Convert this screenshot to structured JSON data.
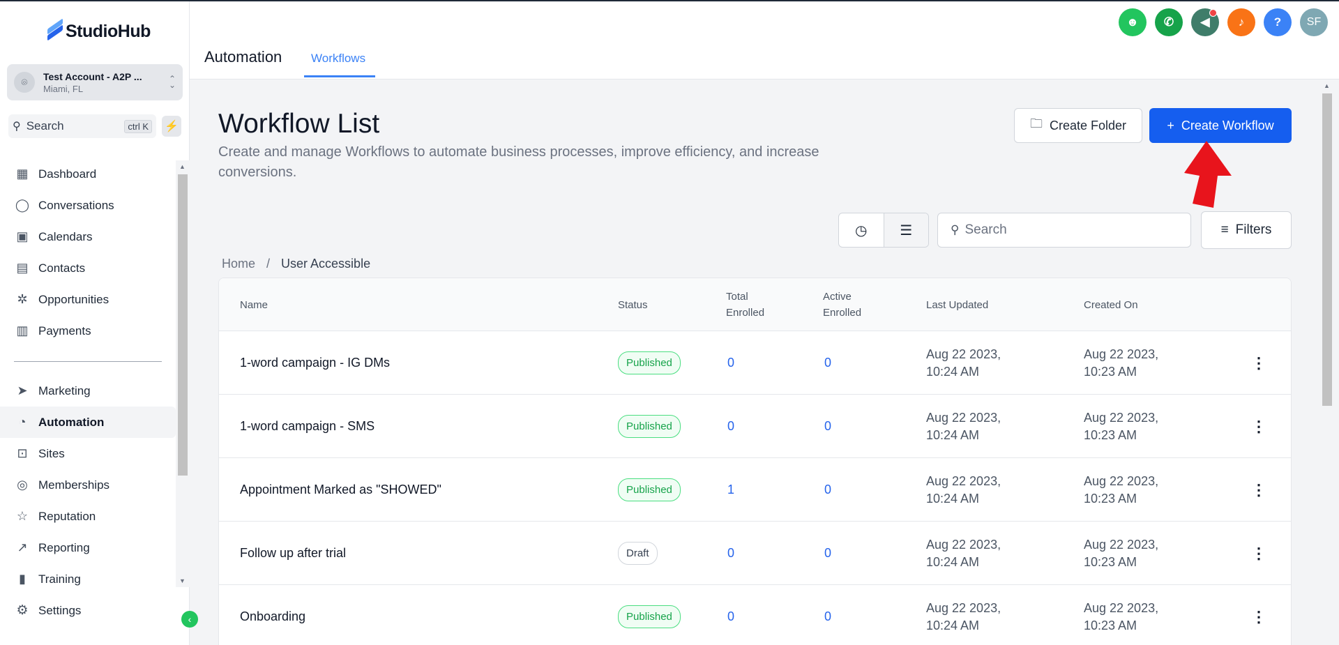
{
  "brand": {
    "name": "StudioHub"
  },
  "account": {
    "name": "Test Account - A2P ...",
    "location": "Miami, FL"
  },
  "sidebar": {
    "search_label": "Search",
    "search_shortcut": "ctrl K",
    "items": [
      {
        "label": "Dashboard",
        "icon": "dashboard-icon",
        "glyph": "▦"
      },
      {
        "label": "Conversations",
        "icon": "chat-bubble-icon",
        "glyph": "◯"
      },
      {
        "label": "Calendars",
        "icon": "calendar-icon",
        "glyph": "▣"
      },
      {
        "label": "Contacts",
        "icon": "contacts-book-icon",
        "glyph": "▤"
      },
      {
        "label": "Opportunities",
        "icon": "opportunities-icon",
        "glyph": "✲"
      },
      {
        "label": "Payments",
        "icon": "payments-icon",
        "glyph": "▥"
      }
    ],
    "items2": [
      {
        "label": "Marketing",
        "icon": "send-icon",
        "glyph": "➤"
      },
      {
        "label": "Automation",
        "icon": "automation-icon",
        "glyph": "◔",
        "active": true
      },
      {
        "label": "Sites",
        "icon": "sites-icon",
        "glyph": "⊡"
      },
      {
        "label": "Memberships",
        "icon": "memberships-icon",
        "glyph": "◎"
      },
      {
        "label": "Reputation",
        "icon": "star-icon",
        "glyph": "☆"
      },
      {
        "label": "Reporting",
        "icon": "trend-icon",
        "glyph": "↗"
      },
      {
        "label": "Training",
        "icon": "book-icon",
        "glyph": "▮"
      }
    ],
    "settings_label": "Settings"
  },
  "header": {
    "title": "Automation",
    "tab": "Workflows",
    "avatar_initials": "SF",
    "icons": [
      {
        "name": "ai-bot-icon",
        "glyph": "☻",
        "color": "#22c55e"
      },
      {
        "name": "phone-icon",
        "glyph": "✆",
        "color": "#16a34a"
      },
      {
        "name": "megaphone-icon",
        "glyph": "◀",
        "color": "#3f7d6a"
      },
      {
        "name": "bell-icon",
        "glyph": "♪",
        "color": "#f97316"
      },
      {
        "name": "help-icon",
        "glyph": "?",
        "color": "#3b82f6"
      }
    ],
    "avatar_color": "#7fa8b3"
  },
  "page": {
    "title": "Workflow List",
    "description": "Create and manage Workflows to automate business processes, improve efficiency, and increase conversions.",
    "create_folder": "Create Folder",
    "create_workflow": "Create Workflow",
    "search_placeholder": "Search",
    "filters": "Filters",
    "breadcrumb": {
      "home": "Home",
      "sep": "/",
      "current": "User Accessible"
    }
  },
  "table": {
    "columns": {
      "name": "Name",
      "status": "Status",
      "total_enrolled": "Total\nEnrolled",
      "active_enrolled": "Active\nEnrolled",
      "last_updated": "Last Updated",
      "created_on": "Created On"
    },
    "rows": [
      {
        "name": "1-word campaign - IG DMs",
        "status": "Published",
        "total": "0",
        "active": "0",
        "updated_date": "Aug 22 2023,",
        "updated_time": "10:24 AM",
        "created_date": "Aug 22 2023,",
        "created_time": "10:23 AM"
      },
      {
        "name": "1-word campaign - SMS",
        "status": "Published",
        "total": "0",
        "active": "0",
        "updated_date": "Aug 22 2023,",
        "updated_time": "10:24 AM",
        "created_date": "Aug 22 2023,",
        "created_time": "10:23 AM"
      },
      {
        "name": "Appointment Marked as \"SHOWED\"",
        "status": "Published",
        "total": "1",
        "active": "0",
        "updated_date": "Aug 22 2023,",
        "updated_time": "10:24 AM",
        "created_date": "Aug 22 2023,",
        "created_time": "10:23 AM"
      },
      {
        "name": "Follow up after trial",
        "status": "Draft",
        "total": "0",
        "active": "0",
        "updated_date": "Aug 22 2023,",
        "updated_time": "10:24 AM",
        "created_date": "Aug 22 2023,",
        "created_time": "10:23 AM"
      },
      {
        "name": "Onboarding",
        "status": "Published",
        "total": "0",
        "active": "0",
        "updated_date": "Aug 22 2023,",
        "updated_time": "10:24 AM",
        "created_date": "Aug 22 2023,",
        "created_time": "10:23 AM"
      }
    ]
  },
  "colors": {
    "accent": "#155eef",
    "brand_green": "#22c55e",
    "published": "#16a34a"
  }
}
